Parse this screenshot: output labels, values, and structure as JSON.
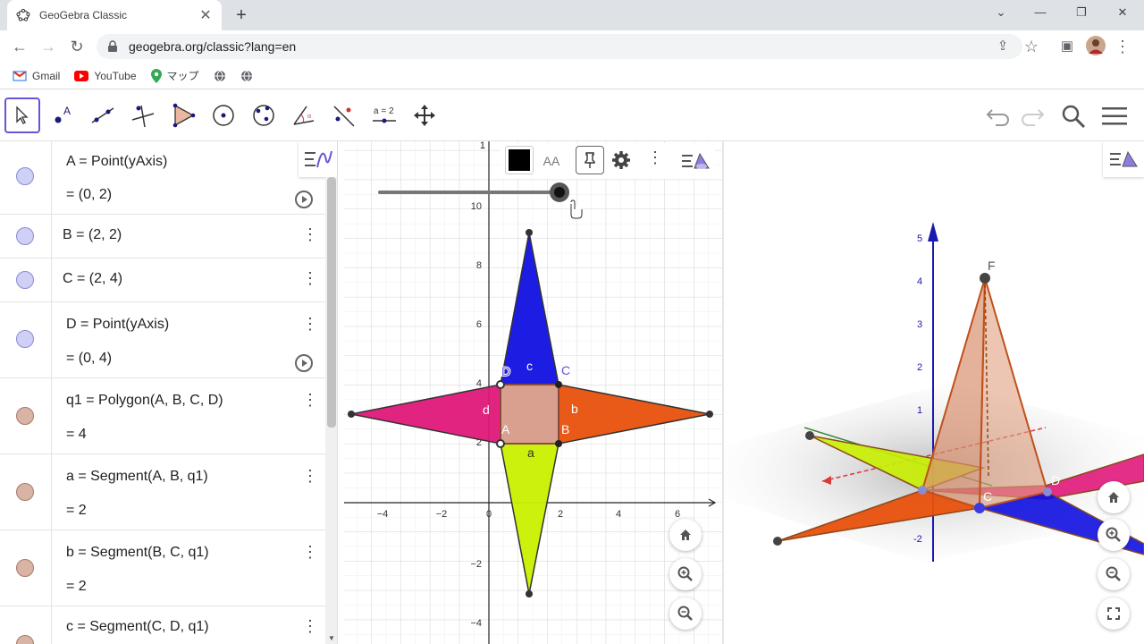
{
  "browser": {
    "tab_title": "GeoGebra Classic",
    "url": "geogebra.org/classic?lang=en",
    "bookmarks": [
      "Gmail",
      "YouTube",
      "マップ"
    ]
  },
  "algebra": {
    "rows": [
      {
        "def": "A  =  Point(yAxis)",
        "value": "=  (0, 2)",
        "kind": "point",
        "play": true
      },
      {
        "def": "B = (2, 2)",
        "value": "",
        "kind": "point",
        "play": false
      },
      {
        "def": "C = (2, 4)",
        "value": "",
        "kind": "point",
        "play": false
      },
      {
        "def": "D  =  Point(yAxis)",
        "value": "=  (0, 4)",
        "kind": "point",
        "play": true
      },
      {
        "def": "q1  =  Polygon(A, B, C, D)",
        "value": "=  4",
        "kind": "poly",
        "play": false
      },
      {
        "def": "a  =  Segment(A, B, q1)",
        "value": "=  2",
        "kind": "poly",
        "play": false
      },
      {
        "def": "b  =  Segment(B, C, q1)",
        "value": "=  2",
        "kind": "poly",
        "play": false
      },
      {
        "def": "c  =  Segment(C, D, q1)",
        "value": "",
        "kind": "poly",
        "play": false
      }
    ]
  },
  "graphics2d": {
    "x_ticks": [
      "−4",
      "−2",
      "0",
      "2",
      "4",
      "6"
    ],
    "y_ticks": [
      "10",
      "8",
      "6",
      "4",
      "2",
      "−2",
      "−4"
    ],
    "labels": {
      "A": "A",
      "B": "B",
      "C": "C",
      "D": "D",
      "a": "a",
      "b": "b",
      "c": "c",
      "d": "d"
    },
    "y_top_label": "1"
  },
  "graphics3d": {
    "z_ticks": [
      "5",
      "4",
      "3",
      "2",
      "1",
      "-2"
    ],
    "labels": {
      "F": "F",
      "D": "D",
      "C": "C"
    }
  },
  "style_bar": {
    "font_label": "AA"
  },
  "tools": {
    "equal_label": "a = 2"
  },
  "colors": {
    "pink": "#e0187a",
    "orange": "#e8500c",
    "blue": "#1010e0",
    "lime": "#c8f000",
    "square": "#d9a08f",
    "accent": "#6557d2"
  }
}
